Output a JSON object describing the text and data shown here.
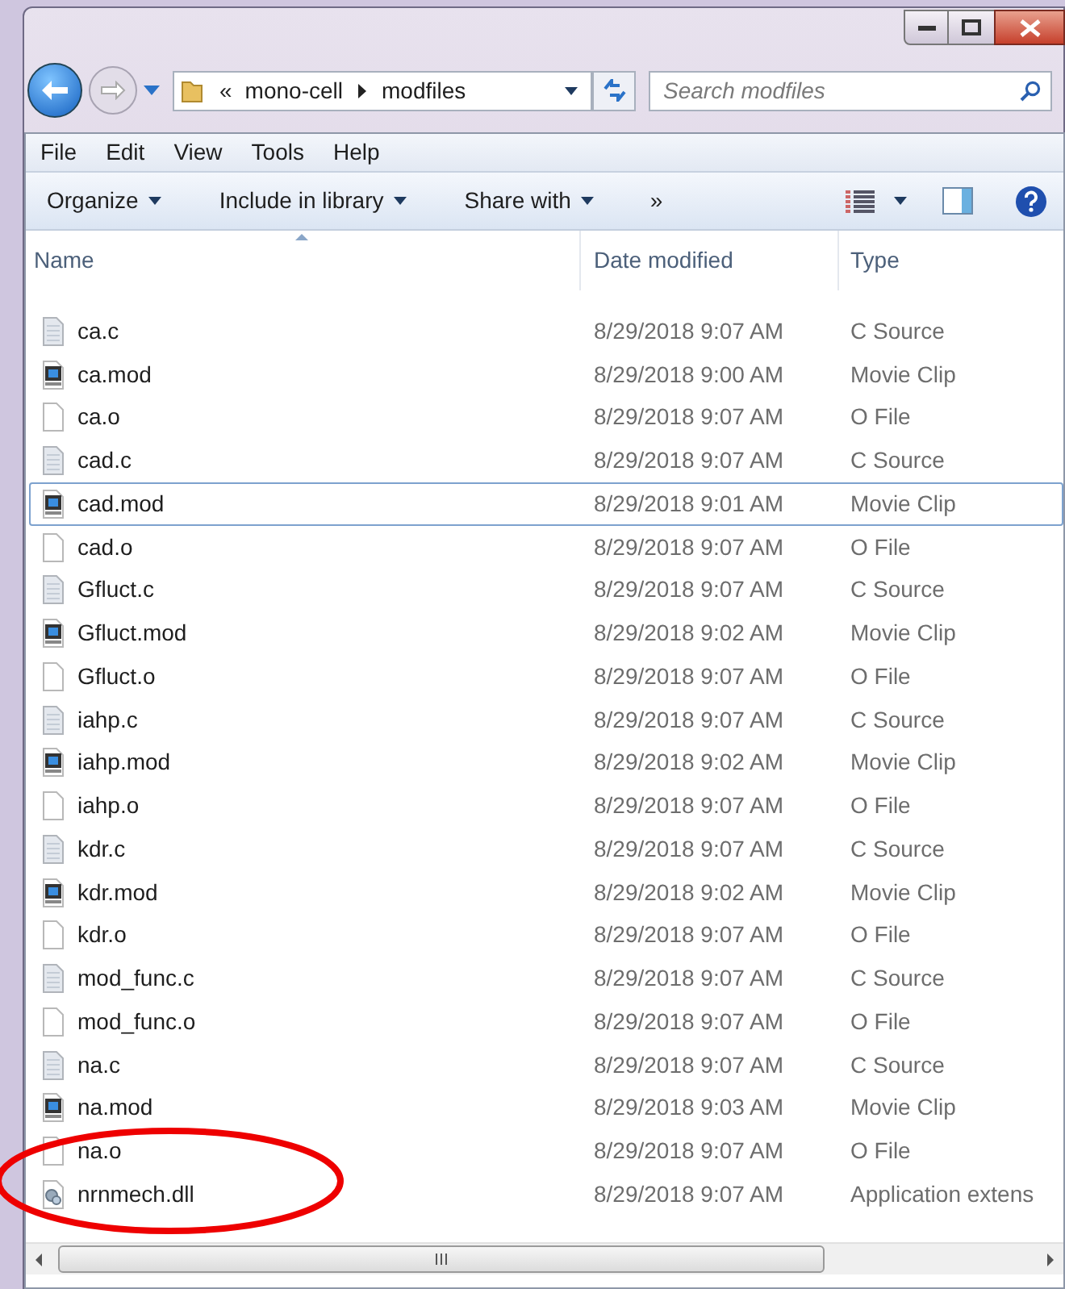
{
  "address": {
    "overflow": "«",
    "crumbs": [
      "mono-cell",
      "modfiles"
    ]
  },
  "search": {
    "placeholder": "Search modfiles"
  },
  "menu": [
    "File",
    "Edit",
    "View",
    "Tools",
    "Help"
  ],
  "toolbar": [
    "Organize",
    "Include in library",
    "Share with"
  ],
  "toolbar_more": "»",
  "columns": [
    "Name",
    "Date modified",
    "Type"
  ],
  "rows": [
    {
      "kind": "c",
      "name": "ca.c",
      "date": "8/29/2018 9:07 AM",
      "type": "C Source",
      "focused": false
    },
    {
      "kind": "mod",
      "name": "ca.mod",
      "date": "8/29/2018 9:00 AM",
      "type": "Movie Clip",
      "focused": false
    },
    {
      "kind": "o",
      "name": "ca.o",
      "date": "8/29/2018 9:07 AM",
      "type": "O File",
      "focused": false
    },
    {
      "kind": "c",
      "name": "cad.c",
      "date": "8/29/2018 9:07 AM",
      "type": "C Source",
      "focused": false
    },
    {
      "kind": "mod",
      "name": "cad.mod",
      "date": "8/29/2018 9:01 AM",
      "type": "Movie Clip",
      "focused": true
    },
    {
      "kind": "o",
      "name": "cad.o",
      "date": "8/29/2018 9:07 AM",
      "type": "O File",
      "focused": false
    },
    {
      "kind": "c",
      "name": "Gfluct.c",
      "date": "8/29/2018 9:07 AM",
      "type": "C Source",
      "focused": false
    },
    {
      "kind": "mod",
      "name": "Gfluct.mod",
      "date": "8/29/2018 9:02 AM",
      "type": "Movie Clip",
      "focused": false
    },
    {
      "kind": "o",
      "name": "Gfluct.o",
      "date": "8/29/2018 9:07 AM",
      "type": "O File",
      "focused": false
    },
    {
      "kind": "c",
      "name": "iahp.c",
      "date": "8/29/2018 9:07 AM",
      "type": "C Source",
      "focused": false
    },
    {
      "kind": "mod",
      "name": "iahp.mod",
      "date": "8/29/2018 9:02 AM",
      "type": "Movie Clip",
      "focused": false
    },
    {
      "kind": "o",
      "name": "iahp.o",
      "date": "8/29/2018 9:07 AM",
      "type": "O File",
      "focused": false
    },
    {
      "kind": "c",
      "name": "kdr.c",
      "date": "8/29/2018 9:07 AM",
      "type": "C Source",
      "focused": false
    },
    {
      "kind": "mod",
      "name": "kdr.mod",
      "date": "8/29/2018 9:02 AM",
      "type": "Movie Clip",
      "focused": false
    },
    {
      "kind": "o",
      "name": "kdr.o",
      "date": "8/29/2018 9:07 AM",
      "type": "O File",
      "focused": false
    },
    {
      "kind": "c",
      "name": "mod_func.c",
      "date": "8/29/2018 9:07 AM",
      "type": "C Source",
      "focused": false
    },
    {
      "kind": "o",
      "name": "mod_func.o",
      "date": "8/29/2018 9:07 AM",
      "type": "O File",
      "focused": false
    },
    {
      "kind": "c",
      "name": "na.c",
      "date": "8/29/2018 9:07 AM",
      "type": "C Source",
      "focused": false
    },
    {
      "kind": "mod",
      "name": "na.mod",
      "date": "8/29/2018 9:03 AM",
      "type": "Movie Clip",
      "focused": false
    },
    {
      "kind": "o",
      "name": "na.o",
      "date": "8/29/2018 9:07 AM",
      "type": "O File",
      "focused": false
    },
    {
      "kind": "dll",
      "name": "nrnmech.dll",
      "date": "8/29/2018 9:07 AM",
      "type": "Application extens",
      "focused": false
    }
  ]
}
